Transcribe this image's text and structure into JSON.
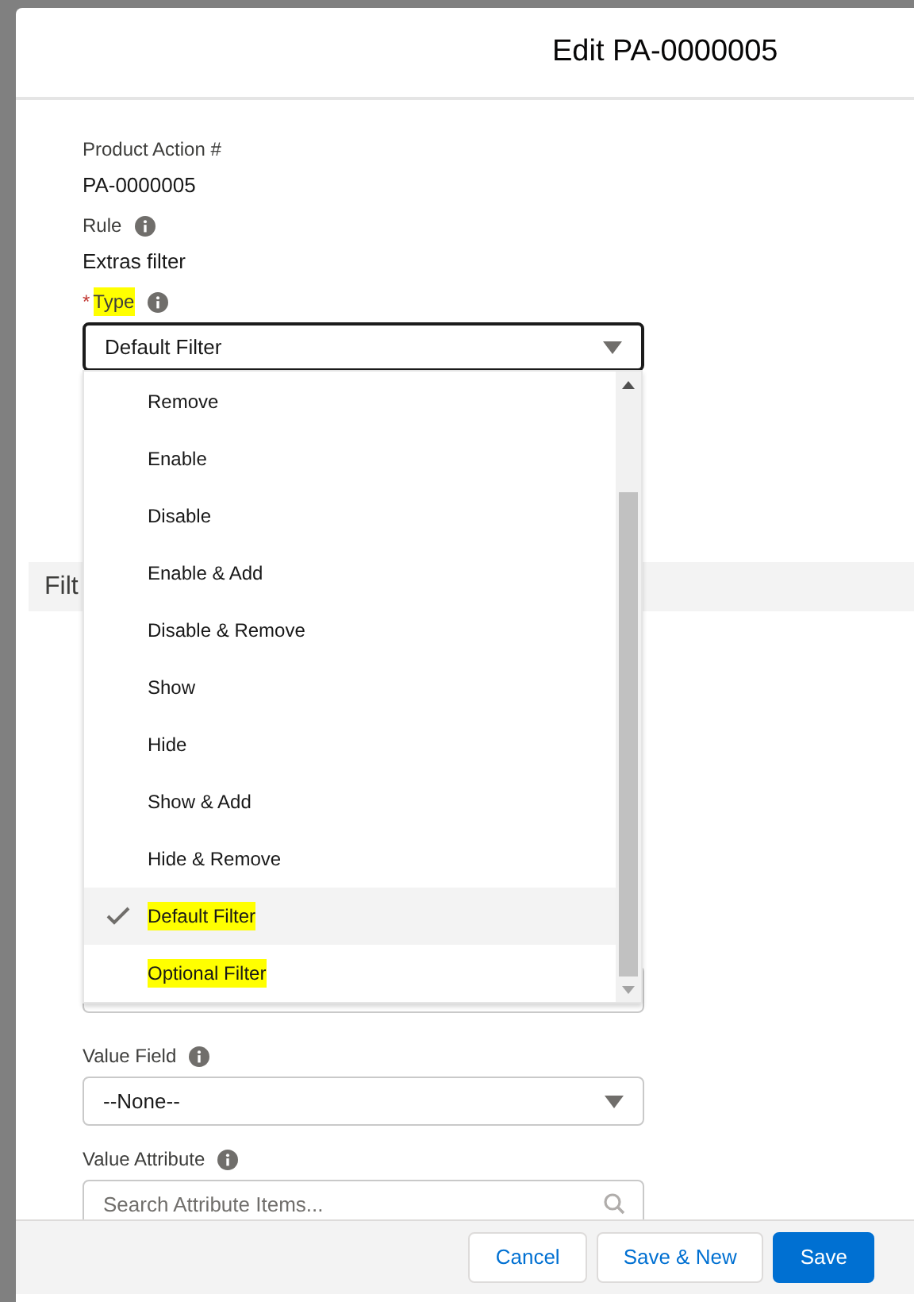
{
  "modal": {
    "title": "Edit PA-0000005"
  },
  "fields": [
    {
      "label": "Product Action #",
      "value": "PA-0000005",
      "info": false
    },
    {
      "label": "Rule",
      "value": "Extras filter",
      "info": true
    }
  ],
  "type_field": {
    "label": "Type",
    "required_mark": "*",
    "info": true,
    "highlighted": true,
    "value": "Default Filter",
    "expanded": true
  },
  "section": {
    "title": "Filt"
  },
  "options": [
    {
      "label": "Remove",
      "selected": false,
      "highlighted": false
    },
    {
      "label": "Enable",
      "selected": false,
      "highlighted": false
    },
    {
      "label": "Disable",
      "selected": false,
      "highlighted": false
    },
    {
      "label": "Enable & Add",
      "selected": false,
      "highlighted": false
    },
    {
      "label": "Disable & Remove",
      "selected": false,
      "highlighted": false
    },
    {
      "label": "Show",
      "selected": false,
      "highlighted": false
    },
    {
      "label": "Hide",
      "selected": false,
      "highlighted": false
    },
    {
      "label": "Show & Add",
      "selected": false,
      "highlighted": false
    },
    {
      "label": "Hide & Remove",
      "selected": false,
      "highlighted": false
    },
    {
      "label": "Default Filter",
      "selected": true,
      "highlighted": true
    },
    {
      "label": "Optional Filter",
      "selected": false,
      "highlighted": true
    }
  ],
  "value_field": {
    "label": "Value Field",
    "info": true,
    "value": "--None--"
  },
  "value_attribute": {
    "label": "Value Attribute",
    "info": true,
    "placeholder": "Search Attribute Items..."
  },
  "buttons": [
    {
      "label": "Cancel",
      "kind": "neutral"
    },
    {
      "label": "Save & New",
      "kind": "neutral"
    },
    {
      "label": "Save",
      "kind": "brand"
    }
  ]
}
